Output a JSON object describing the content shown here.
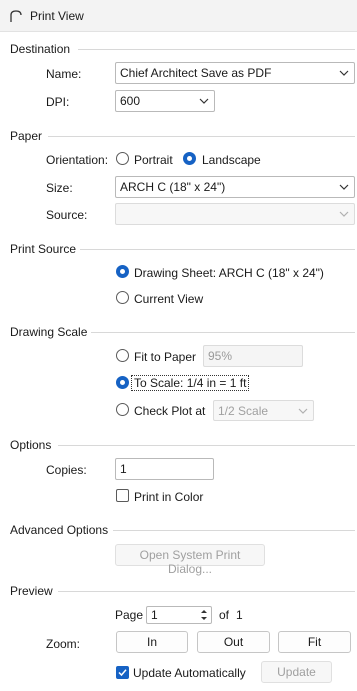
{
  "window": {
    "title": "Print View"
  },
  "destination": {
    "group_label": "Destination",
    "name_label": "Name:",
    "name_value": "Chief Architect Save as PDF",
    "dpi_label": "DPI:",
    "dpi_value": "600"
  },
  "paper": {
    "group_label": "Paper",
    "orientation_label": "Orientation:",
    "portrait_label": "Portrait",
    "landscape_label": "Landscape",
    "orientation_selected": "Landscape",
    "size_label": "Size:",
    "size_value": "ARCH C  (18\" x 24\")",
    "source_label": "Source:",
    "source_value": ""
  },
  "print_source": {
    "group_label": "Print Source",
    "drawing_sheet_label": "Drawing Sheet: ARCH C  (18\" x 24\")",
    "current_view_label": "Current View",
    "selected": "Drawing Sheet"
  },
  "drawing_scale": {
    "group_label": "Drawing Scale",
    "fit_to_paper_label": "Fit to Paper",
    "fit_to_paper_value": "95%",
    "to_scale_label": "To Scale: 1/4 in = 1 ft",
    "check_plot_label": "Check Plot at",
    "check_plot_value": "1/2 Scale",
    "selected": "To Scale"
  },
  "options": {
    "group_label": "Options",
    "copies_label": "Copies:",
    "copies_value": "1",
    "print_in_color_label": "Print in Color",
    "print_in_color_checked": false
  },
  "advanced": {
    "group_label": "Advanced Options",
    "system_dialog_button": "Open System Print Dialog..."
  },
  "preview": {
    "group_label": "Preview",
    "page_label": "Page",
    "page_value": "1",
    "of_label": "of",
    "page_total": "1",
    "zoom_label": "Zoom:",
    "zoom_in_label": "In",
    "zoom_out_label": "Out",
    "zoom_fit_label": "Fit",
    "update_auto_label": "Update Automatically",
    "update_auto_checked": true,
    "update_button": "Update"
  },
  "colors": {
    "accent": "#1662c4",
    "border": "#b9b9b9",
    "separator": "#d8d8d8"
  }
}
